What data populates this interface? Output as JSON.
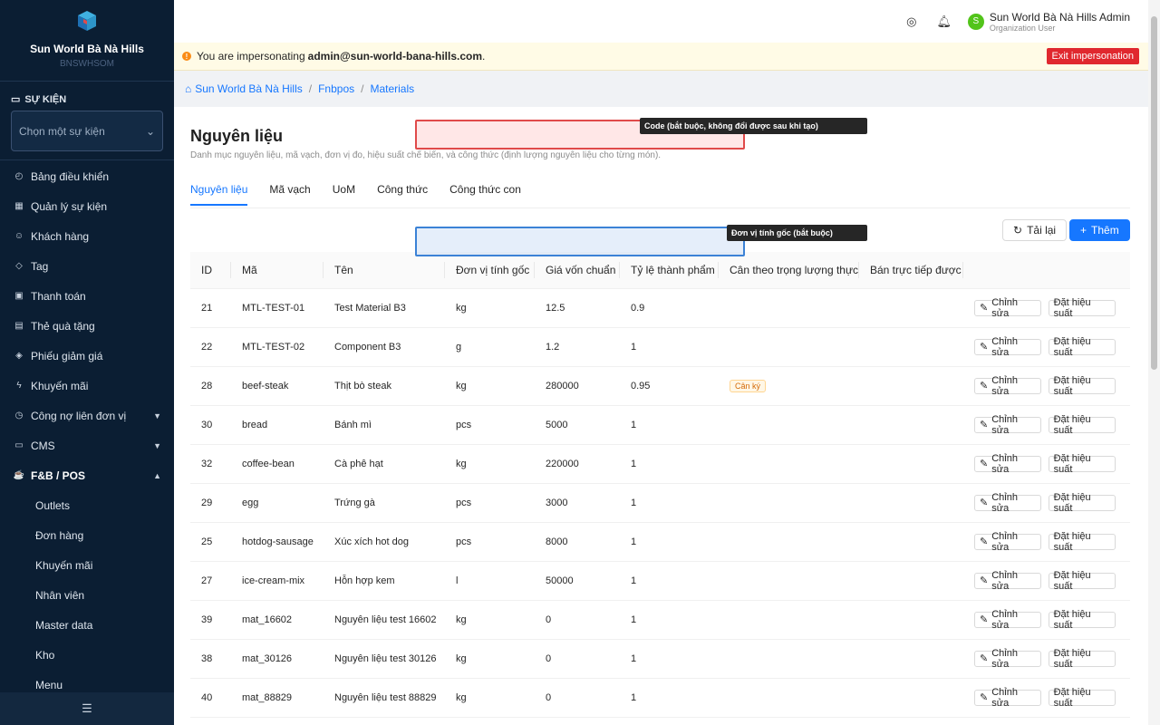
{
  "sidebar": {
    "brand_name": "Sun World Bà Nà Hills",
    "brand_sub": "BNSWHSOM",
    "section_label": "SỰ KIỆN",
    "event_select_placeholder": "Chọn một sự kiện",
    "items": [
      {
        "label": "Bảng điều khiển",
        "icon": "dashboard-icon"
      },
      {
        "label": "Quản lý sự kiện",
        "icon": "calendar-icon"
      },
      {
        "label": "Khách hàng",
        "icon": "users-icon"
      },
      {
        "label": "Tag",
        "icon": "tag-icon"
      },
      {
        "label": "Thanh toán",
        "icon": "payment-icon"
      },
      {
        "label": "Thẻ quà tặng",
        "icon": "gift-icon"
      },
      {
        "label": "Phiếu giảm giá",
        "icon": "coupon-icon"
      },
      {
        "label": "Khuyến mãi",
        "icon": "promo-icon"
      },
      {
        "label": "Công nợ liên đơn vị",
        "icon": "debt-icon",
        "chevron": "down"
      },
      {
        "label": "CMS",
        "icon": "cms-icon",
        "chevron": "down"
      },
      {
        "label": "F&B / POS",
        "icon": "fnb-icon",
        "chevron": "up",
        "bold": true
      }
    ],
    "sub_items": [
      "Outlets",
      "Đơn hàng",
      "Khuyến mãi",
      "Nhân viên",
      "Master data",
      "Kho",
      "Menu"
    ]
  },
  "topbar": {
    "user_initial": "S",
    "user_name": "Sun World Bà Nà Hills Admin",
    "user_role": "Organization User"
  },
  "impersonation": {
    "prefix": "You are impersonating ",
    "email": "admin@sun-world-bana-hills.com",
    "suffix": ".",
    "exit_label": "Exit impersonation"
  },
  "breadcrumb": [
    "Sun World Bà Nà Hills",
    "Fnbpos",
    "Materials"
  ],
  "page": {
    "title": "Nguyên liệu",
    "description": "Danh mục nguyên liệu, mã vạch, đơn vị đo, hiệu suất chế biến, và công thức (định lượng nguyên liệu cho từng món).",
    "tabs": [
      "Nguyên liệu",
      "Mã vạch",
      "UoM",
      "Công thức",
      "Công thức con"
    ],
    "reload_label": "Tải lại",
    "add_label": "Thêm"
  },
  "tooltips": {
    "code": "Code (bắt buộc, không đổi được sau khi tạo)",
    "uom": "Đơn vị tính gốc (bắt buộc)"
  },
  "table": {
    "columns": [
      "ID",
      "Mã",
      "Tên",
      "Đơn vị tính gốc",
      "Giá vốn chuẩn",
      "Tỷ lệ thành phẩm",
      "Cân theo trọng lượng thực",
      "Bán trực tiếp được"
    ],
    "edit_label": "Chỉnh sửa",
    "yield_label": "Đặt hiệu suất",
    "rows": [
      {
        "id": "21",
        "code": "MTL-TEST-01",
        "name": "Test Material B3",
        "uom": "kg",
        "cost": "12.5",
        "yield": "0.9",
        "weigh": "",
        "direct": ""
      },
      {
        "id": "22",
        "code": "MTL-TEST-02",
        "name": "Component B3",
        "uom": "g",
        "cost": "1.2",
        "yield": "1",
        "weigh": "",
        "direct": ""
      },
      {
        "id": "28",
        "code": "beef-steak",
        "name": "Thịt bò steak",
        "uom": "kg",
        "cost": "280000",
        "yield": "0.95",
        "weigh": "Cân ký",
        "direct": ""
      },
      {
        "id": "30",
        "code": "bread",
        "name": "Bánh mì",
        "uom": "pcs",
        "cost": "5000",
        "yield": "1",
        "weigh": "",
        "direct": ""
      },
      {
        "id": "32",
        "code": "coffee-bean",
        "name": "Cà phê hạt",
        "uom": "kg",
        "cost": "220000",
        "yield": "1",
        "weigh": "",
        "direct": ""
      },
      {
        "id": "29",
        "code": "egg",
        "name": "Trứng gà",
        "uom": "pcs",
        "cost": "3000",
        "yield": "1",
        "weigh": "",
        "direct": ""
      },
      {
        "id": "25",
        "code": "hotdog-sausage",
        "name": "Xúc xích hot dog",
        "uom": "pcs",
        "cost": "8000",
        "yield": "1",
        "weigh": "",
        "direct": ""
      },
      {
        "id": "27",
        "code": "ice-cream-mix",
        "name": "Hỗn hợp kem",
        "uom": "l",
        "cost": "50000",
        "yield": "1",
        "weigh": "",
        "direct": ""
      },
      {
        "id": "39",
        "code": "mat_16602",
        "name": "Nguyên liệu test 16602",
        "uom": "kg",
        "cost": "0",
        "yield": "1",
        "weigh": "",
        "direct": ""
      },
      {
        "id": "38",
        "code": "mat_30126",
        "name": "Nguyên liệu test 30126",
        "uom": "kg",
        "cost": "0",
        "yield": "1",
        "weigh": "",
        "direct": ""
      },
      {
        "id": "40",
        "code": "mat_88829",
        "name": "Nguyên liệu test 88829",
        "uom": "kg",
        "cost": "0",
        "yield": "1",
        "weigh": "",
        "direct": ""
      }
    ]
  }
}
